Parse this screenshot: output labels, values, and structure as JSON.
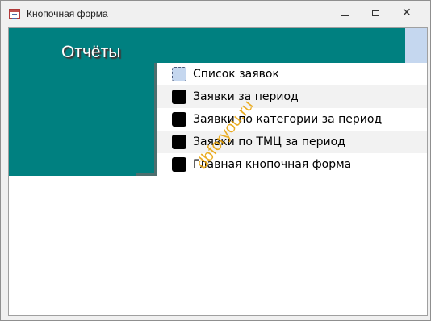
{
  "window": {
    "title": "Кнопочная форма",
    "icon": "form-icon",
    "controls": [
      "minimize-icon",
      "maximize-icon",
      "close-icon"
    ]
  },
  "form": {
    "header_title": "Отчёты",
    "accent_color": "#008080",
    "menu_items": [
      {
        "label": "Список заявок",
        "selected": true
      },
      {
        "label": "Заявки за период",
        "selected": false
      },
      {
        "label": "Заявки по категории за период",
        "selected": false
      },
      {
        "label": "Заявки по ТМЦ за период",
        "selected": false
      },
      {
        "label": "Главная кнопочная форма",
        "selected": false
      }
    ]
  },
  "watermark": {
    "text": "dbforyou.ru",
    "color": "#e8a000"
  }
}
